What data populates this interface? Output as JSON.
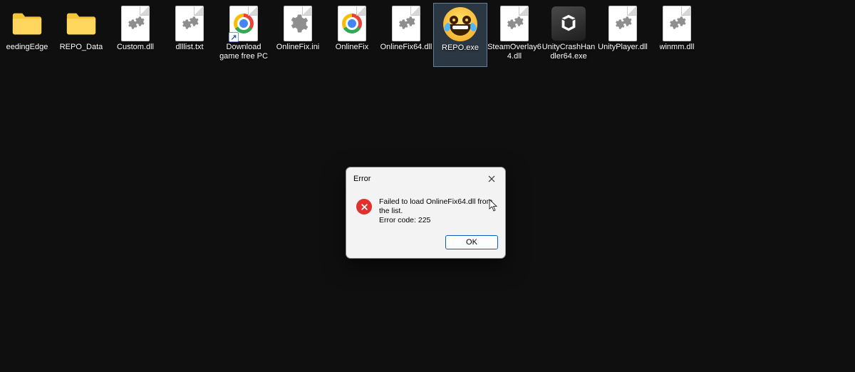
{
  "desktop": {
    "items": [
      {
        "label": "eedingEdge",
        "type": "folder",
        "selected": false
      },
      {
        "label": "REPO_Data",
        "type": "folder",
        "selected": false
      },
      {
        "label": "Custom.dll",
        "type": "dll",
        "selected": false
      },
      {
        "label": "dlllist.txt",
        "type": "txt",
        "selected": false
      },
      {
        "label": "Download game free PC",
        "type": "chrome-shortcut",
        "selected": false
      },
      {
        "label": "OnlineFix.ini",
        "type": "ini",
        "selected": false
      },
      {
        "label": "OnlineFix",
        "type": "chrome",
        "selected": false
      },
      {
        "label": "OnlineFix64.dll",
        "type": "dll",
        "selected": false
      },
      {
        "label": "REPO.exe",
        "type": "repo-exe",
        "selected": true
      },
      {
        "label": "SteamOverlay64.dll",
        "type": "dll",
        "selected": false
      },
      {
        "label": "UnityCrashHandler64.exe",
        "type": "unity-exe",
        "selected": false
      },
      {
        "label": "UnityPlayer.dll",
        "type": "dll",
        "selected": false
      },
      {
        "label": "winmm.dll",
        "type": "dll",
        "selected": false
      }
    ]
  },
  "dialog": {
    "title": "Error",
    "message_line1": "Failed to load OnlineFix64.dll from the list.",
    "message_line2": "Error code: 225",
    "ok_label": "OK"
  }
}
